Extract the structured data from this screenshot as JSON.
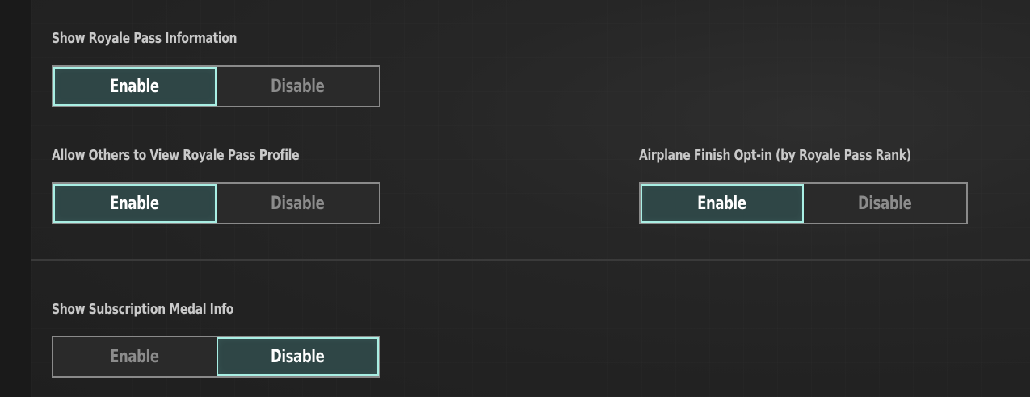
{
  "settings": [
    {
      "label": "Show Royale Pass Information",
      "options": [
        "Enable",
        "Disable"
      ],
      "selected": "Enable"
    },
    {
      "label": "Allow Others to View Royale Pass Profile",
      "options": [
        "Enable",
        "Disable"
      ],
      "selected": "Enable"
    },
    {
      "label": "Airplane Finish Opt-in (by Royale Pass Rank)",
      "options": [
        "Enable",
        "Disable"
      ],
      "selected": "Enable"
    },
    {
      "label": "Show Subscription Medal Info",
      "options": [
        "Enable",
        "Disable"
      ],
      "selected": "Disable"
    }
  ],
  "colors": {
    "background": "#1f1f1f",
    "active_fill": "#2f4646",
    "active_border": "#a9efe4",
    "inactive_text": "#8c8c8c",
    "label_text": "#c9c9c9"
  }
}
